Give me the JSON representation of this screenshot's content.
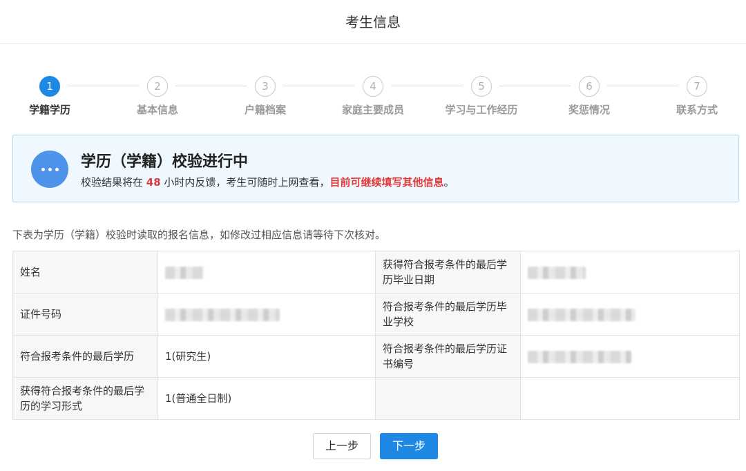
{
  "header": {
    "title": "考生信息"
  },
  "steps": [
    {
      "number": "1",
      "label": "学籍学历",
      "active": true
    },
    {
      "number": "2",
      "label": "基本信息",
      "active": false
    },
    {
      "number": "3",
      "label": "户籍档案",
      "active": false
    },
    {
      "number": "4",
      "label": "家庭主要成员",
      "active": false
    },
    {
      "number": "5",
      "label": "学习与工作经历",
      "active": false
    },
    {
      "number": "6",
      "label": "奖惩情况",
      "active": false
    },
    {
      "number": "7",
      "label": "联系方式",
      "active": false
    }
  ],
  "notice": {
    "title": "学历（学籍）校验进行中",
    "text_before": "校验结果将在 ",
    "hours": "48",
    "text_middle": " 小时内反馈，考生可随时上网查看，",
    "highlight": "目前可继续填写其他信息",
    "text_end": "。",
    "icon": "more-dots-icon"
  },
  "description": "下表为学历（学籍）校验时读取的报名信息，如修改过相应信息请等待下次核对。",
  "table": {
    "rows": [
      {
        "label_left": "姓名",
        "value_left": "",
        "label_right": "获得符合报考条件的最后学历毕业日期",
        "value_right": ""
      },
      {
        "label_left": "证件号码",
        "value_left": "",
        "label_right": "符合报考条件的最后学历毕业学校",
        "value_right": ""
      },
      {
        "label_left": "符合报考条件的最后学历",
        "value_left": "1(研究生)",
        "label_right": "符合报考条件的最后学历证书编号",
        "value_right": ""
      },
      {
        "label_left": "获得符合报考条件的最后学历的学习形式",
        "value_left": "1(普通全日制)",
        "label_right": "",
        "value_right": ""
      }
    ]
  },
  "buttons": {
    "prev": "上一步",
    "next": "下一步"
  },
  "colors": {
    "accent": "#1e88e5",
    "highlight": "#e03b3b",
    "notice_bg": "#eef8fe"
  }
}
